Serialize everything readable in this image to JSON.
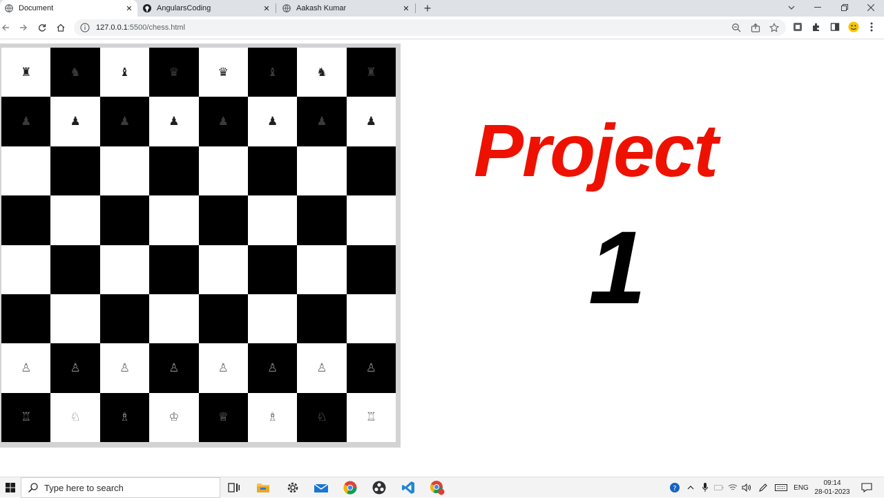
{
  "browser": {
    "tabs": [
      {
        "label": "Document",
        "active": true
      },
      {
        "label": "AngularsCoding",
        "active": false
      },
      {
        "label": "Aakash Kumar",
        "active": false
      }
    ],
    "url_host": "127.0.0.1",
    "url_path": ":5500/chess.html",
    "icons": {
      "back": "arrow-left-icon",
      "forward": "arrow-right-icon",
      "reload": "reload-icon",
      "home": "home-icon",
      "site_info": "info-icon",
      "zoom": "zoom-icon",
      "share": "share-icon",
      "bookmark": "star-icon"
    }
  },
  "page": {
    "board": {
      "light_color": "#ffffff",
      "dark_color": "#000000",
      "rows": [
        [
          {
            "p": "♜",
            "c": "black"
          },
          {
            "p": "♞",
            "c": "black"
          },
          {
            "p": "♝",
            "c": "black"
          },
          {
            "p": "♛",
            "c": "black"
          },
          {
            "p": "♛",
            "c": "black"
          },
          {
            "p": "♝",
            "c": "black"
          },
          {
            "p": "♞",
            "c": "black"
          },
          {
            "p": "♜",
            "c": "black"
          }
        ],
        [
          {
            "p": "♟",
            "c": "black"
          },
          {
            "p": "♟",
            "c": "black"
          },
          {
            "p": "♟",
            "c": "black"
          },
          {
            "p": "♟",
            "c": "black"
          },
          {
            "p": "♟",
            "c": "black"
          },
          {
            "p": "♟",
            "c": "black"
          },
          {
            "p": "♟",
            "c": "black"
          },
          {
            "p": "♟",
            "c": "black"
          }
        ],
        [
          {
            "p": "",
            "c": ""
          },
          {
            "p": "",
            "c": ""
          },
          {
            "p": "",
            "c": ""
          },
          {
            "p": "",
            "c": ""
          },
          {
            "p": "",
            "c": ""
          },
          {
            "p": "",
            "c": ""
          },
          {
            "p": "",
            "c": ""
          },
          {
            "p": "",
            "c": ""
          }
        ],
        [
          {
            "p": "",
            "c": ""
          },
          {
            "p": "",
            "c": ""
          },
          {
            "p": "",
            "c": ""
          },
          {
            "p": "",
            "c": ""
          },
          {
            "p": "",
            "c": ""
          },
          {
            "p": "",
            "c": ""
          },
          {
            "p": "",
            "c": ""
          },
          {
            "p": "",
            "c": ""
          }
        ],
        [
          {
            "p": "",
            "c": ""
          },
          {
            "p": "",
            "c": ""
          },
          {
            "p": "",
            "c": ""
          },
          {
            "p": "",
            "c": ""
          },
          {
            "p": "",
            "c": ""
          },
          {
            "p": "",
            "c": ""
          },
          {
            "p": "",
            "c": ""
          },
          {
            "p": "",
            "c": ""
          }
        ],
        [
          {
            "p": "",
            "c": ""
          },
          {
            "p": "",
            "c": ""
          },
          {
            "p": "",
            "c": ""
          },
          {
            "p": "",
            "c": ""
          },
          {
            "p": "",
            "c": ""
          },
          {
            "p": "",
            "c": ""
          },
          {
            "p": "",
            "c": ""
          },
          {
            "p": "",
            "c": ""
          }
        ],
        [
          {
            "p": "♙",
            "c": "white"
          },
          {
            "p": "♙",
            "c": "white"
          },
          {
            "p": "♙",
            "c": "white"
          },
          {
            "p": "♙",
            "c": "white"
          },
          {
            "p": "♙",
            "c": "white"
          },
          {
            "p": "♙",
            "c": "white"
          },
          {
            "p": "♙",
            "c": "white"
          },
          {
            "p": "♙",
            "c": "white"
          }
        ],
        [
          {
            "p": "♖",
            "c": "white"
          },
          {
            "p": "♘",
            "c": "white"
          },
          {
            "p": "♗",
            "c": "white"
          },
          {
            "p": "♔",
            "c": "white"
          },
          {
            "p": "♕",
            "c": "white"
          },
          {
            "p": "♗",
            "c": "white"
          },
          {
            "p": "♘",
            "c": "white"
          },
          {
            "p": "♖",
            "c": "white"
          }
        ]
      ]
    },
    "heading": "Project",
    "heading_color": "#ee1100",
    "number": "1"
  },
  "taskbar": {
    "search_placeholder": "Type here to search",
    "language": "ENG",
    "time": "09:14",
    "date": "28-01-2023",
    "apps": [
      "task-view-icon",
      "file-explorer-icon",
      "settings-icon",
      "mail-icon",
      "chrome-icon",
      "obs-icon",
      "vscode-icon",
      "chrome-canary-icon"
    ]
  }
}
